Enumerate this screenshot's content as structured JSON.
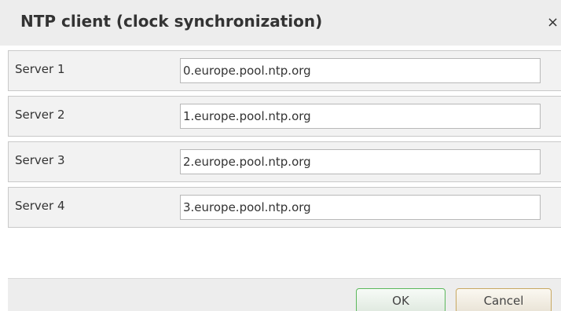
{
  "dialog": {
    "title": "NTP client (clock synchronization)",
    "close_symbol": "×"
  },
  "servers": [
    {
      "label": "Server 1",
      "value": "0.europe.pool.ntp.org"
    },
    {
      "label": "Server 2",
      "value": "1.europe.pool.ntp.org"
    },
    {
      "label": "Server 3",
      "value": "2.europe.pool.ntp.org"
    },
    {
      "label": "Server 4",
      "value": "3.europe.pool.ntp.org"
    }
  ],
  "buttons": {
    "ok": "OK",
    "cancel": "Cancel"
  },
  "colors": {
    "ok_border": "#5cb85c",
    "cancel_border": "#c8a862",
    "title_bar": "#ededed",
    "row_background": "#f2f2f2"
  }
}
